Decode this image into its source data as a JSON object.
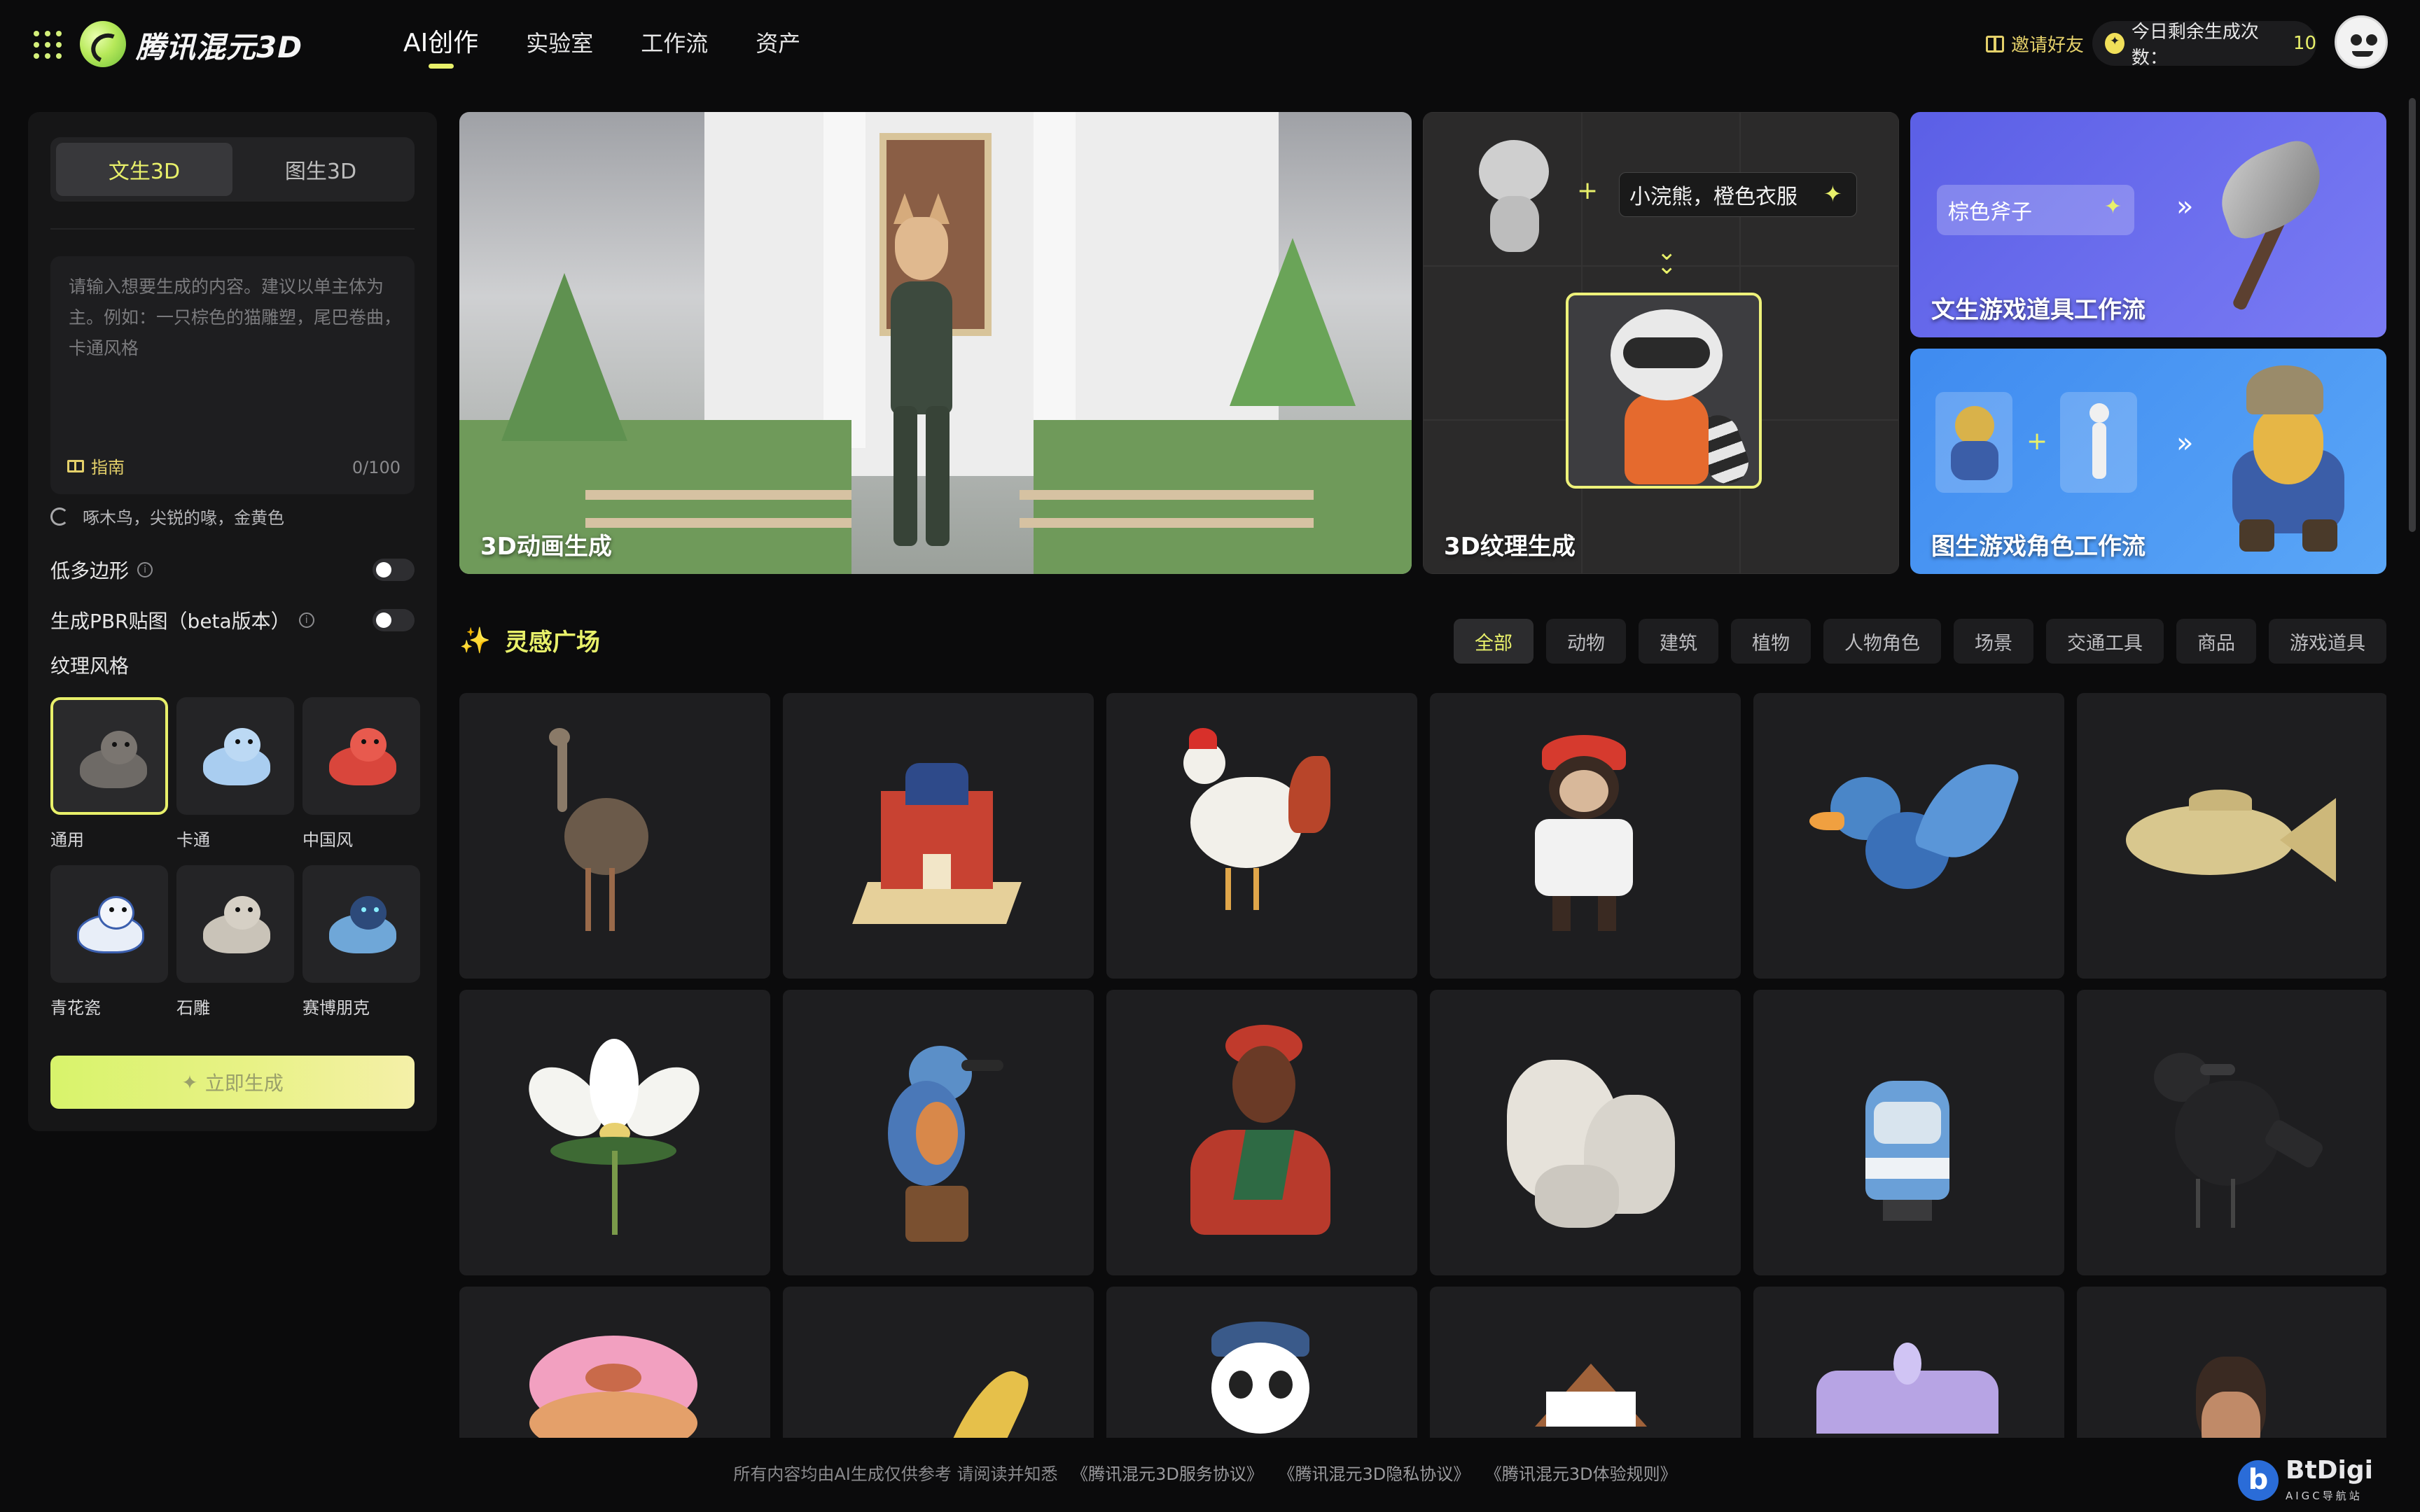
{
  "brand": {
    "name": "腾讯混元3D"
  },
  "nav": {
    "items": [
      {
        "label": "AI创作",
        "active": true
      },
      {
        "label": "实验室",
        "active": false
      },
      {
        "label": "工作流",
        "active": false
      },
      {
        "label": "资产",
        "active": false
      }
    ]
  },
  "header": {
    "invite_label": "邀请好友",
    "quota_label": "今日剩余生成次数：",
    "quota_value": "10"
  },
  "panel": {
    "tabs": [
      {
        "label": "文生3D",
        "active": true
      },
      {
        "label": "图生3D",
        "active": false
      }
    ],
    "prompt": {
      "placeholder": "请输入想要生成的内容。建议以单主体为主。例如：一只棕色的猫雕塑，尾巴卷曲，卡通风格",
      "value": "",
      "guide_label": "指南",
      "counter": "0/100"
    },
    "suggestion": "啄木鸟，尖锐的喙，金黄色",
    "options": [
      {
        "label": "低多边形",
        "enabled": false
      },
      {
        "label": "生成PBR贴图（beta版本）",
        "enabled": false
      }
    ],
    "style_title": "纹理风格",
    "styles": [
      {
        "label": "通用",
        "active": true,
        "color": "#6e6a66"
      },
      {
        "label": "卡通",
        "active": false,
        "color": "#a9cdf0"
      },
      {
        "label": "中国风",
        "active": false,
        "color": "#d9463c"
      },
      {
        "label": "青花瓷",
        "active": false,
        "color": "#e8eef8"
      },
      {
        "label": "石雕",
        "active": false,
        "color": "#c9c3b8"
      },
      {
        "label": "赛博朋克",
        "active": false,
        "color": "#6fa7d8"
      }
    ],
    "generate_label": "立即生成"
  },
  "banners": {
    "animation": {
      "label": "3D动画生成"
    },
    "texture": {
      "label": "3D纹理生成",
      "input_text": "小浣熊，橙色衣服"
    },
    "prop": {
      "label": "文生游戏道具工作流",
      "input_text": "棕色斧子"
    },
    "character": {
      "label": "图生游戏角色工作流"
    }
  },
  "inspiration": {
    "title": "灵感广场",
    "filters": [
      {
        "label": "全部",
        "active": true
      },
      {
        "label": "动物",
        "active": false
      },
      {
        "label": "建筑",
        "active": false
      },
      {
        "label": "植物",
        "active": false
      },
      {
        "label": "人物角色",
        "active": false
      },
      {
        "label": "场景",
        "active": false
      },
      {
        "label": "交通工具",
        "active": false
      },
      {
        "label": "商品",
        "active": false
      },
      {
        "label": "游戏道具",
        "active": false
      }
    ],
    "items": [
      {
        "subject": "ostrich",
        "color": "#6b5a4a"
      },
      {
        "subject": "red-building",
        "color": "#c84232"
      },
      {
        "subject": "rooster",
        "color": "#f2f0ea"
      },
      {
        "subject": "monkey",
        "color": "#d63a2e"
      },
      {
        "subject": "blue-bird",
        "color": "#4a86c8"
      },
      {
        "subject": "fish",
        "color": "#d8c78e"
      },
      {
        "subject": "white-flower",
        "color": "#f4f4f0"
      },
      {
        "subject": "kingfisher",
        "color": "#5b8fc8"
      },
      {
        "subject": "woman-bust",
        "color": "#c03a2c"
      },
      {
        "subject": "white-rock",
        "color": "#e6e2da"
      },
      {
        "subject": "train",
        "color": "#6aa0d8"
      },
      {
        "subject": "crow",
        "color": "#2a2a2c"
      },
      {
        "subject": "donut",
        "color": "#f2a0c0"
      },
      {
        "subject": "banana",
        "color": "#e6c04a"
      },
      {
        "subject": "panda",
        "color": "#ffffff"
      },
      {
        "subject": "cabin",
        "color": "#a0623a"
      },
      {
        "subject": "crown",
        "color": "#b7a4e4"
      },
      {
        "subject": "man-head",
        "color": "#3a2a22"
      }
    ]
  },
  "footer": {
    "notice": "所有内容均由AI生成仅供参考 请阅读并知悉",
    "links": [
      "《腾讯混元3D服务协议》",
      "《腾讯混元3D隐私协议》",
      "《腾讯混元3D体验规则》"
    ]
  },
  "watermark": {
    "text": "BtDigi",
    "sub": "AIGC导航站"
  }
}
